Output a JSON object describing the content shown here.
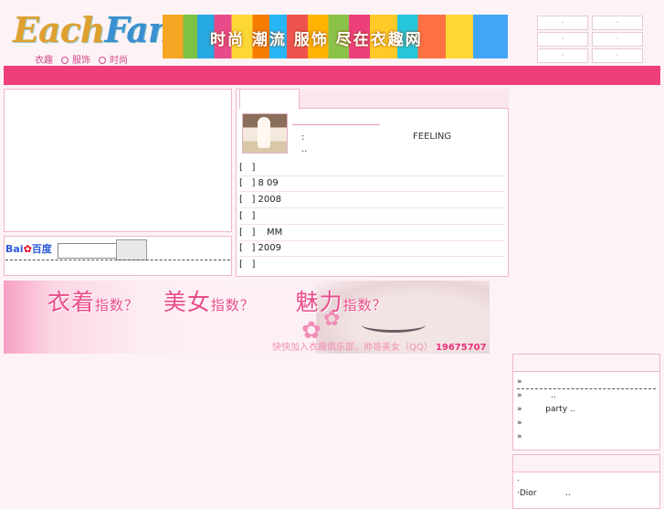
{
  "logo": {
    "part1": "Each",
    "part2": "Fan"
  },
  "taglines": [
    "衣趣",
    "服饰",
    "时尚"
  ],
  "banner_text": "时尚 潮流 服饰 尽在衣趣网",
  "top_buttons": [
    "·",
    "·",
    "·",
    "·",
    "·",
    "·"
  ],
  "search": {
    "brand_part1": "Bai",
    "brand_part2": "百度",
    "input_value": ""
  },
  "feature": {
    "colon": ":",
    "text": "FEELING",
    "dots": ".."
  },
  "article_list": [
    "[   ]",
    "[   ] 8 09",
    "[   ] 2008",
    "[   ]",
    "[   ]    MM",
    "[   ] 2009",
    "[   ]"
  ],
  "promo": {
    "title_1": "衣着",
    "title_1s": "指数？",
    "title_2": "美女",
    "title_2s": "指数？",
    "title_3": "魅力",
    "title_3s": "指数？",
    "sub": "快快加入衣趣俱乐部，帅哥美女（QQ）",
    "qq": "19675707"
  },
  "right_list_1": [
    "»",
    "»           ..",
    "»         party ..",
    "»",
    "»"
  ],
  "right_list_2": [
    ".",
    "·Dior           .."
  ]
}
